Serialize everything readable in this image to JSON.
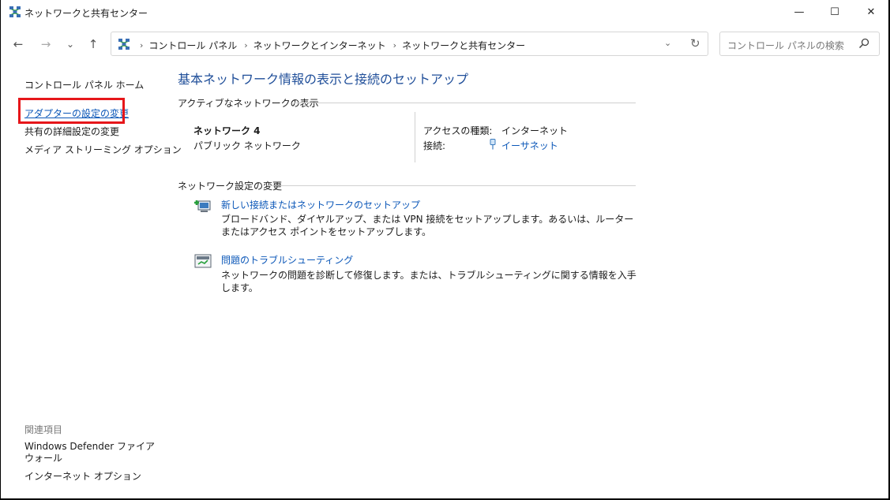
{
  "window": {
    "title": "ネットワークと共有センター",
    "controls": {
      "minimize": "—",
      "maximize": "☐",
      "close": "✕"
    }
  },
  "nav": {
    "back_icon": "←",
    "forward_icon": "→",
    "recent_icon": "⌄",
    "up_icon": "↑",
    "breadcrumbs": [
      "コントロール パネル",
      "ネットワークとインターネット",
      "ネットワークと共有センター"
    ],
    "separator": "›",
    "dropdown_icon": "⌄",
    "refresh_icon": "↻"
  },
  "search": {
    "placeholder": "コントロール パネルの検索"
  },
  "sidebar": {
    "home": "コントロール パネル ホーム",
    "links": [
      "アダプターの設定の変更",
      "共有の詳細設定の変更",
      "メディア ストリーミング オプション"
    ],
    "related_heading": "関連項目",
    "related_links": [
      "Windows Defender ファイアウォール",
      "インターネット オプション"
    ]
  },
  "main": {
    "title": "基本ネットワーク情報の表示と接続のセットアップ",
    "active_header": "アクティブなネットワークの表示",
    "network": {
      "name": "ネットワーク 4",
      "type": "パブリック ネットワーク",
      "access_label": "アクセスの種類:",
      "access_value": "インターネット",
      "connection_label": "接続:",
      "connection_value": "イーサネット"
    },
    "change_header": "ネットワーク設定の変更",
    "tasks": [
      {
        "title": "新しい接続またはネットワークのセットアップ",
        "desc": "ブロードバンド、ダイヤルアップ、または VPN 接続をセットアップします。あるいは、ルーターまたはアクセス ポイントをセットアップします。"
      },
      {
        "title": "問題のトラブルシューティング",
        "desc": "ネットワークの問題を診断して修復します。または、トラブルシューティングに関する情報を入手します。"
      }
    ]
  },
  "colors": {
    "link": "#0b57b8",
    "title": "#1f4e99",
    "highlight": "#e6161a"
  }
}
